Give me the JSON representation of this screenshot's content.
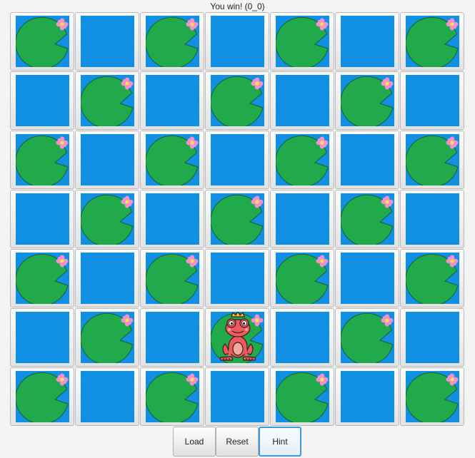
{
  "status_text": "You win! (0_0)",
  "board": {
    "rows": 7,
    "cols": 7,
    "cells": [
      [
        "pad",
        "water",
        "pad",
        "water",
        "pad",
        "water",
        "pad"
      ],
      [
        "water",
        "pad",
        "water",
        "pad",
        "water",
        "pad",
        "water"
      ],
      [
        "pad",
        "water",
        "pad",
        "water",
        "pad",
        "water",
        "pad"
      ],
      [
        "water",
        "pad",
        "water",
        "pad",
        "water",
        "pad",
        "water"
      ],
      [
        "pad",
        "water",
        "pad",
        "water",
        "pad",
        "water",
        "pad"
      ],
      [
        "water",
        "pad",
        "water",
        "frog",
        "water",
        "pad",
        "water"
      ],
      [
        "pad",
        "water",
        "pad",
        "water",
        "pad",
        "water",
        "pad"
      ]
    ]
  },
  "colors": {
    "water": "#1190e3",
    "lily_pad": "#21aa4b",
    "lily_pad_outline": "#1a5e2c",
    "flower": "#f78fcf",
    "flower_center": "#f7e24a",
    "frog": "#ec5b5f",
    "crown": "#f5c542"
  },
  "icons": {
    "pad": "lily-pad-flower-icon",
    "frog": "frog-prince-icon"
  },
  "buttons": {
    "load": "Load",
    "reset": "Reset",
    "hint": "Hint"
  }
}
